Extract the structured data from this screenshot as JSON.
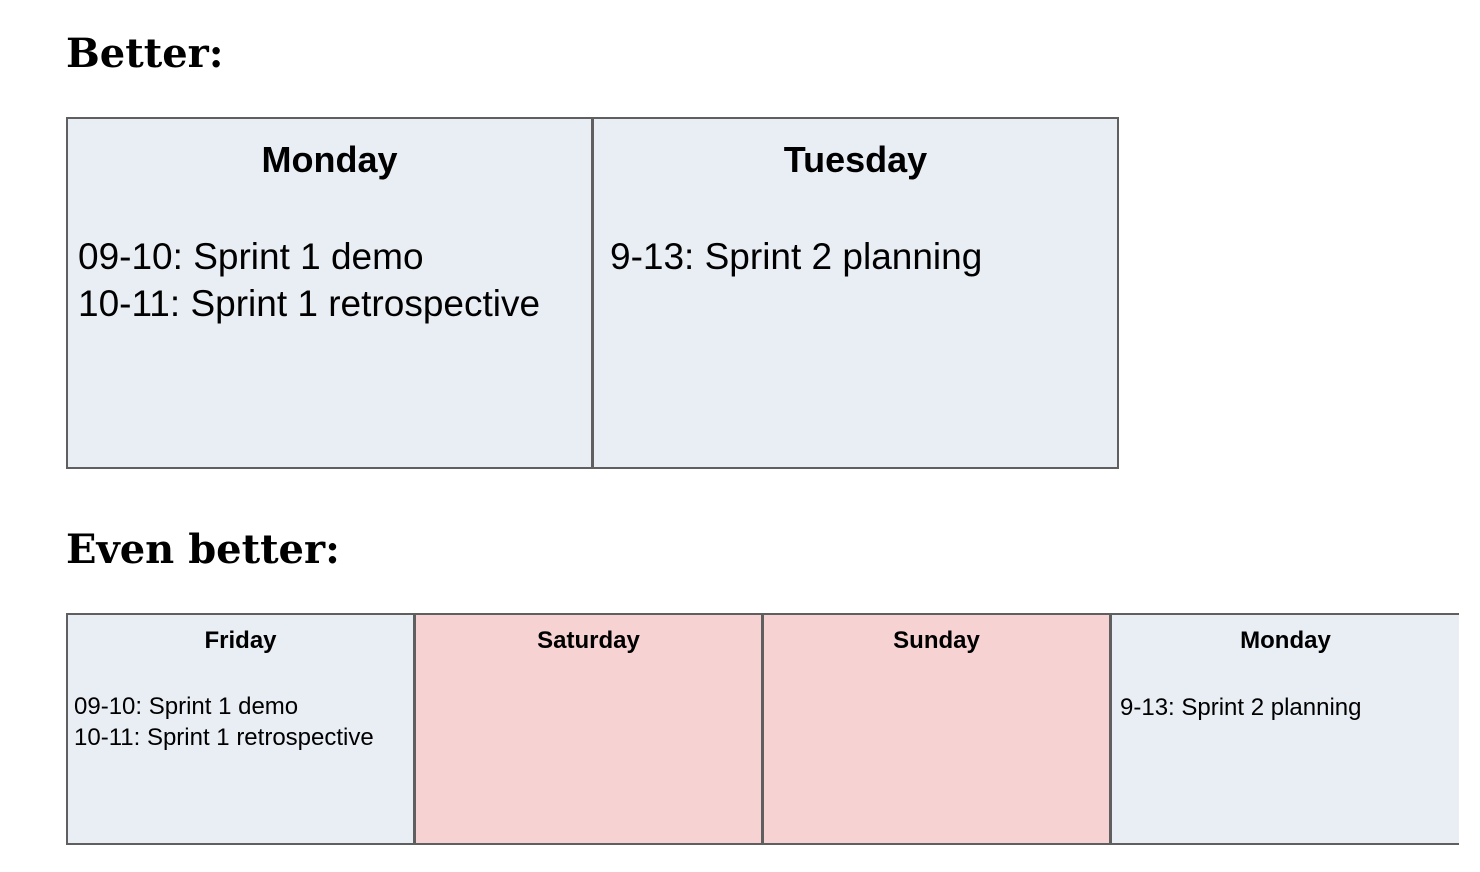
{
  "sections": [
    {
      "heading": "Better:",
      "days": [
        {
          "name": "Monday",
          "kind": "workday",
          "events": [
            "09-10: Sprint 1 demo",
            "10-11: Sprint 1 retrospective"
          ]
        },
        {
          "name": "Tuesday",
          "kind": "workday",
          "events": [
            "9-13: Sprint 2 planning"
          ]
        }
      ]
    },
    {
      "heading": "Even better:",
      "days": [
        {
          "name": "Friday",
          "kind": "workday",
          "events": [
            "09-10: Sprint 1 demo",
            "10-11: Sprint 1 retrospective"
          ]
        },
        {
          "name": "Saturday",
          "kind": "weekend",
          "events": []
        },
        {
          "name": "Sunday",
          "kind": "weekend",
          "events": []
        },
        {
          "name": "Monday",
          "kind": "workday",
          "events": [
            "9-13: Sprint 2 planning"
          ]
        }
      ]
    }
  ],
  "colors": {
    "workday": "#e9edf4",
    "weekend": "#f6d2d2",
    "border": "#5f5f5f"
  }
}
